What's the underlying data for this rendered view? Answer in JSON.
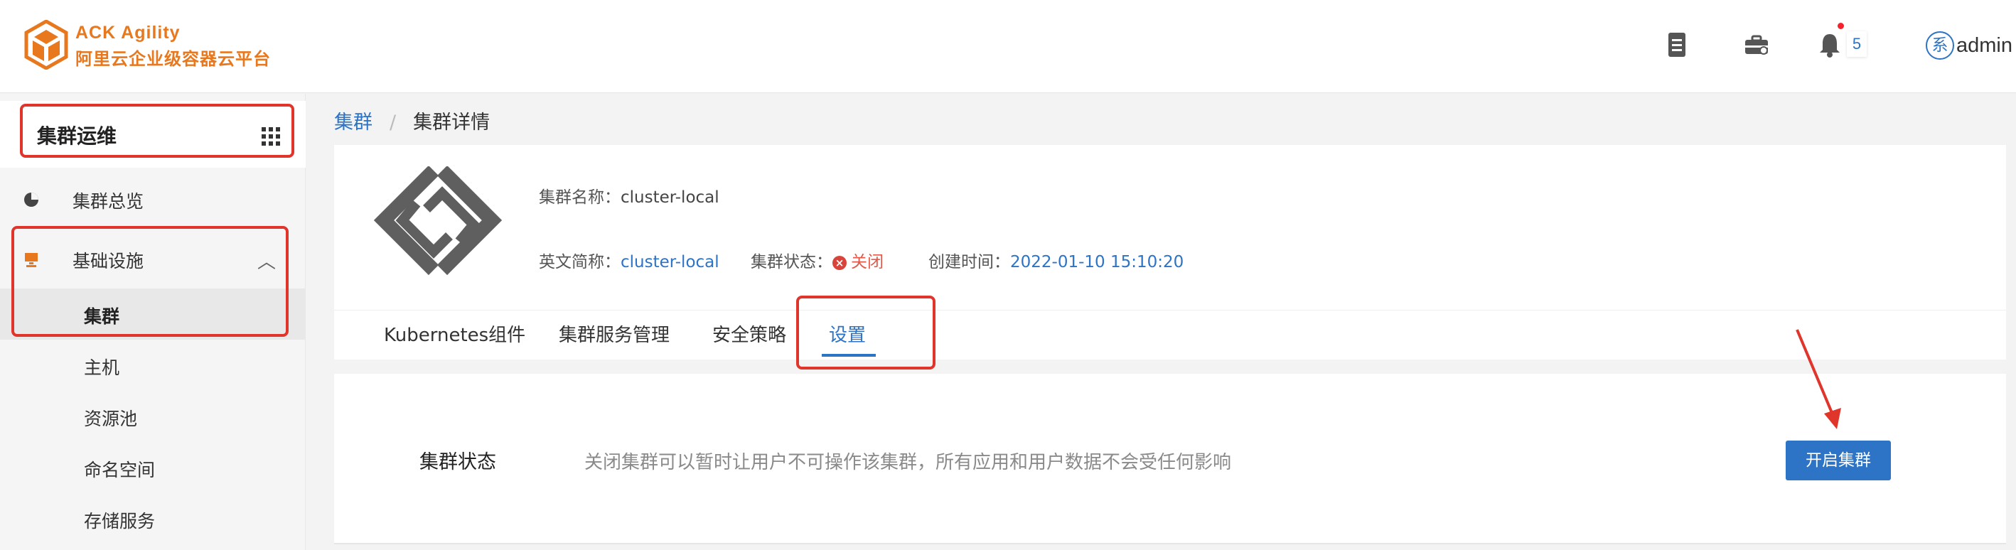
{
  "header": {
    "brand_line1": "ACK  Agility",
    "brand_line2": "阿里云企业级容器云平台",
    "notification_count": "5",
    "avatar_text": "系",
    "username": "admin",
    "icons": [
      "document-icon",
      "toolbox-icon",
      "bell-icon"
    ]
  },
  "sidebar": {
    "title": "集群运维",
    "items": [
      {
        "label": "集群总览",
        "icon": "pie-chart-icon"
      },
      {
        "label": "基础设施",
        "icon": "server-icon",
        "expanded": true
      },
      {
        "label": "集群",
        "active": true
      },
      {
        "label": "主机"
      },
      {
        "label": "资源池"
      },
      {
        "label": "命名空间"
      },
      {
        "label": "存储服务"
      }
    ]
  },
  "breadcrumb": {
    "root": "集群",
    "separator": "/",
    "current": "集群详情"
  },
  "cluster": {
    "name_label": "集群名称：",
    "name_value": "cluster-local",
    "short_label": "英文简称：",
    "short_value": "cluster-local",
    "status_label": "集群状态：",
    "status_value": "关闭",
    "created_label": "创建时间：",
    "created_value": "2022-01-10 15:10:20"
  },
  "tabs": [
    {
      "label": "Kubernetes组件"
    },
    {
      "label": "集群服务管理"
    },
    {
      "label": "安全策略"
    },
    {
      "label": "设置",
      "active": true
    }
  ],
  "settings": {
    "label": "集群状态",
    "description": "关闭集群可以暂时让用户不可操作该集群，所有应用和用户数据不会受任何影响",
    "button": "开启集群"
  },
  "colors": {
    "brand": "#e8781e",
    "primary": "#2d73c6",
    "annotation": "#e0352b"
  }
}
